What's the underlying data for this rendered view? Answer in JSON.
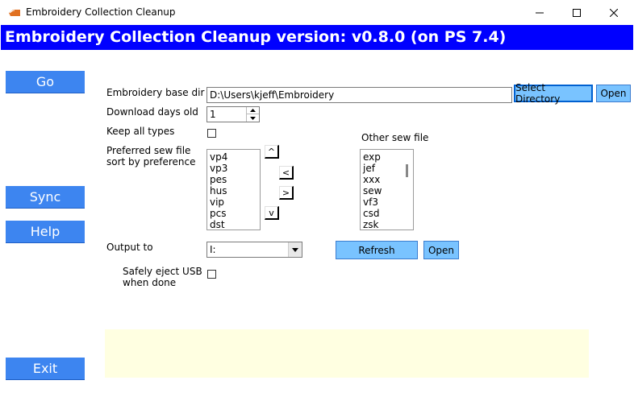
{
  "window": {
    "title": "Embroidery Collection Cleanup",
    "icons": [
      "app-icon",
      "minimize-icon",
      "maximize-icon",
      "close-icon"
    ]
  },
  "banner": {
    "text": "Embroidery Collection Cleanup version: v0.8.0 (on PS 7.4)",
    "color": "#0000ff"
  },
  "sidebar": {
    "go": "Go",
    "sync": "Sync",
    "help": "Help",
    "exit": "Exit",
    "color": "#3d85f0"
  },
  "form": {
    "base_dir": {
      "label": "Embroidery base dir",
      "value": "D:\\Users\\kjeff\\Embroidery",
      "select_button": "Select Directory",
      "open_button": "Open"
    },
    "download_days": {
      "label": "Download days old",
      "value": "1"
    },
    "keep_all_types": {
      "label": "Keep all types",
      "checked": false
    },
    "preferred": {
      "label_line1": "Preferred sew file",
      "label_line2": "sort by preference",
      "items": [
        "vp4",
        "vp3",
        "pes",
        "hus",
        "vip",
        "pcs",
        "dst"
      ],
      "up": "^",
      "left": "<",
      "right": ">",
      "down": "v"
    },
    "other": {
      "label": "Other sew file",
      "items": [
        "exp",
        "jef",
        "xxx",
        "sew",
        "vf3",
        "csd",
        "zsk"
      ]
    },
    "output": {
      "label": "Output to",
      "value": "I:",
      "refresh_button": "Refresh",
      "open_button": "Open"
    },
    "eject": {
      "label_line1": "Safely eject USB",
      "label_line2": "when done",
      "checked": false
    }
  },
  "status": {
    "text": "",
    "color": "#ffffe1"
  }
}
